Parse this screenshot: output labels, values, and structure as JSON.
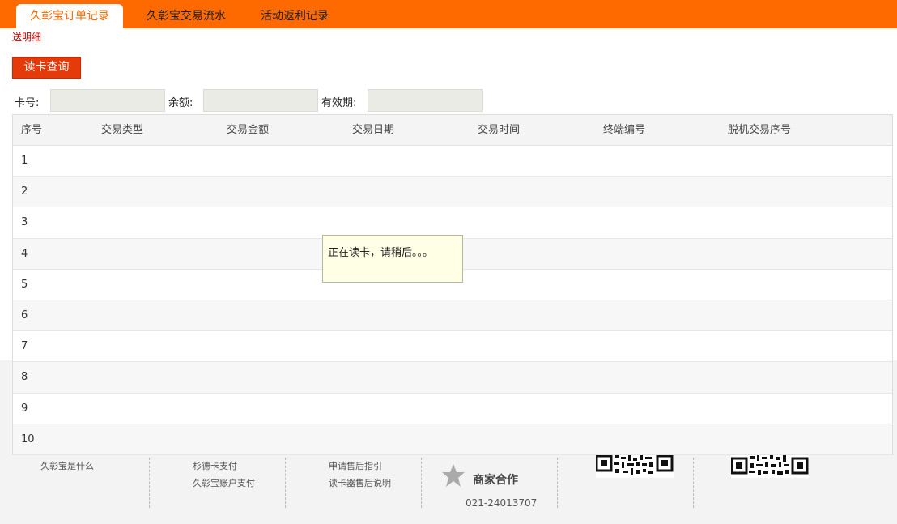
{
  "tabs": [
    {
      "label": "久彰宝订单记录",
      "active": true
    },
    {
      "label": "久彰宝交易流水",
      "active": false
    },
    {
      "label": "活动返利记录",
      "active": false
    }
  ],
  "subtitle": "送明细",
  "read_button": "读卡查询",
  "fields": {
    "card_no": {
      "label": "卡号:",
      "value": ""
    },
    "balance": {
      "label": "余额:",
      "value": ""
    },
    "expiry": {
      "label": "有效期:",
      "value": ""
    }
  },
  "table": {
    "headers": [
      "序号",
      "交易类型",
      "交易金额",
      "交易日期",
      "交易时间",
      "终端编号",
      "脱机交易序号"
    ],
    "rows": [
      "1",
      "2",
      "3",
      "4",
      "5",
      "6",
      "7",
      "8",
      "9",
      "10"
    ]
  },
  "loading_message": "正在读卡，请稍后。。。",
  "footer": {
    "icons": [
      "help-circle-icon",
      "info-icon",
      "users-icon",
      "phone-icon"
    ],
    "col1": [
      "久彰宝是什么"
    ],
    "col2": [
      "杉德卡支付",
      "久彰宝账户支付"
    ],
    "col3": [
      "申请售后指引",
      "读卡器售后说明"
    ],
    "merchant_title": "商家合作",
    "merchant_phone": "021-24013707"
  },
  "colors": {
    "brand": "#ff6a00",
    "button": "#e53a0a",
    "subtitle": "#cc0000"
  }
}
